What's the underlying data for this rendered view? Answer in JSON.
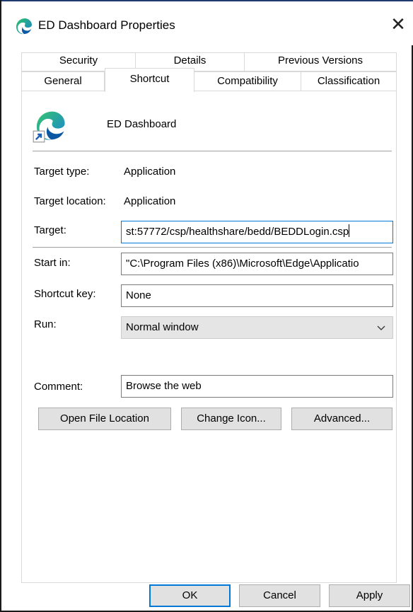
{
  "window": {
    "title": "ED Dashboard Properties",
    "close_glyph": "✕"
  },
  "tabs": {
    "row1": [
      "Security",
      "Details",
      "Previous Versions"
    ],
    "row2": [
      "General",
      "Shortcut",
      "Compatibility",
      "Classification"
    ],
    "active": "Shortcut"
  },
  "shortcut": {
    "name": "ED Dashboard",
    "icon": "edge-shortcut-icon",
    "target_type_label": "Target type:",
    "target_type_value": "Application",
    "target_location_label": "Target location:",
    "target_location_value": "Application",
    "target_label": "Target:",
    "target_value": "st:57772/csp/healthshare/bedd/BEDDLogin.csp",
    "start_in_label": "Start in:",
    "start_in_value": "\"C:\\Program Files (x86)\\Microsoft\\Edge\\Applicatio",
    "shortcut_key_label": "Shortcut key:",
    "shortcut_key_value": "None",
    "run_label": "Run:",
    "run_value": "Normal window",
    "comment_label": "Comment:",
    "comment_value": "Browse the web"
  },
  "actions": {
    "open_file_location": "Open File Location",
    "change_icon": "Change Icon...",
    "advanced": "Advanced..."
  },
  "footer": {
    "ok": "OK",
    "cancel": "Cancel",
    "apply": "Apply"
  },
  "colors": {
    "accent": "#0078d7",
    "button_face": "#e1e1e1",
    "select_face": "#e5e5e5"
  }
}
